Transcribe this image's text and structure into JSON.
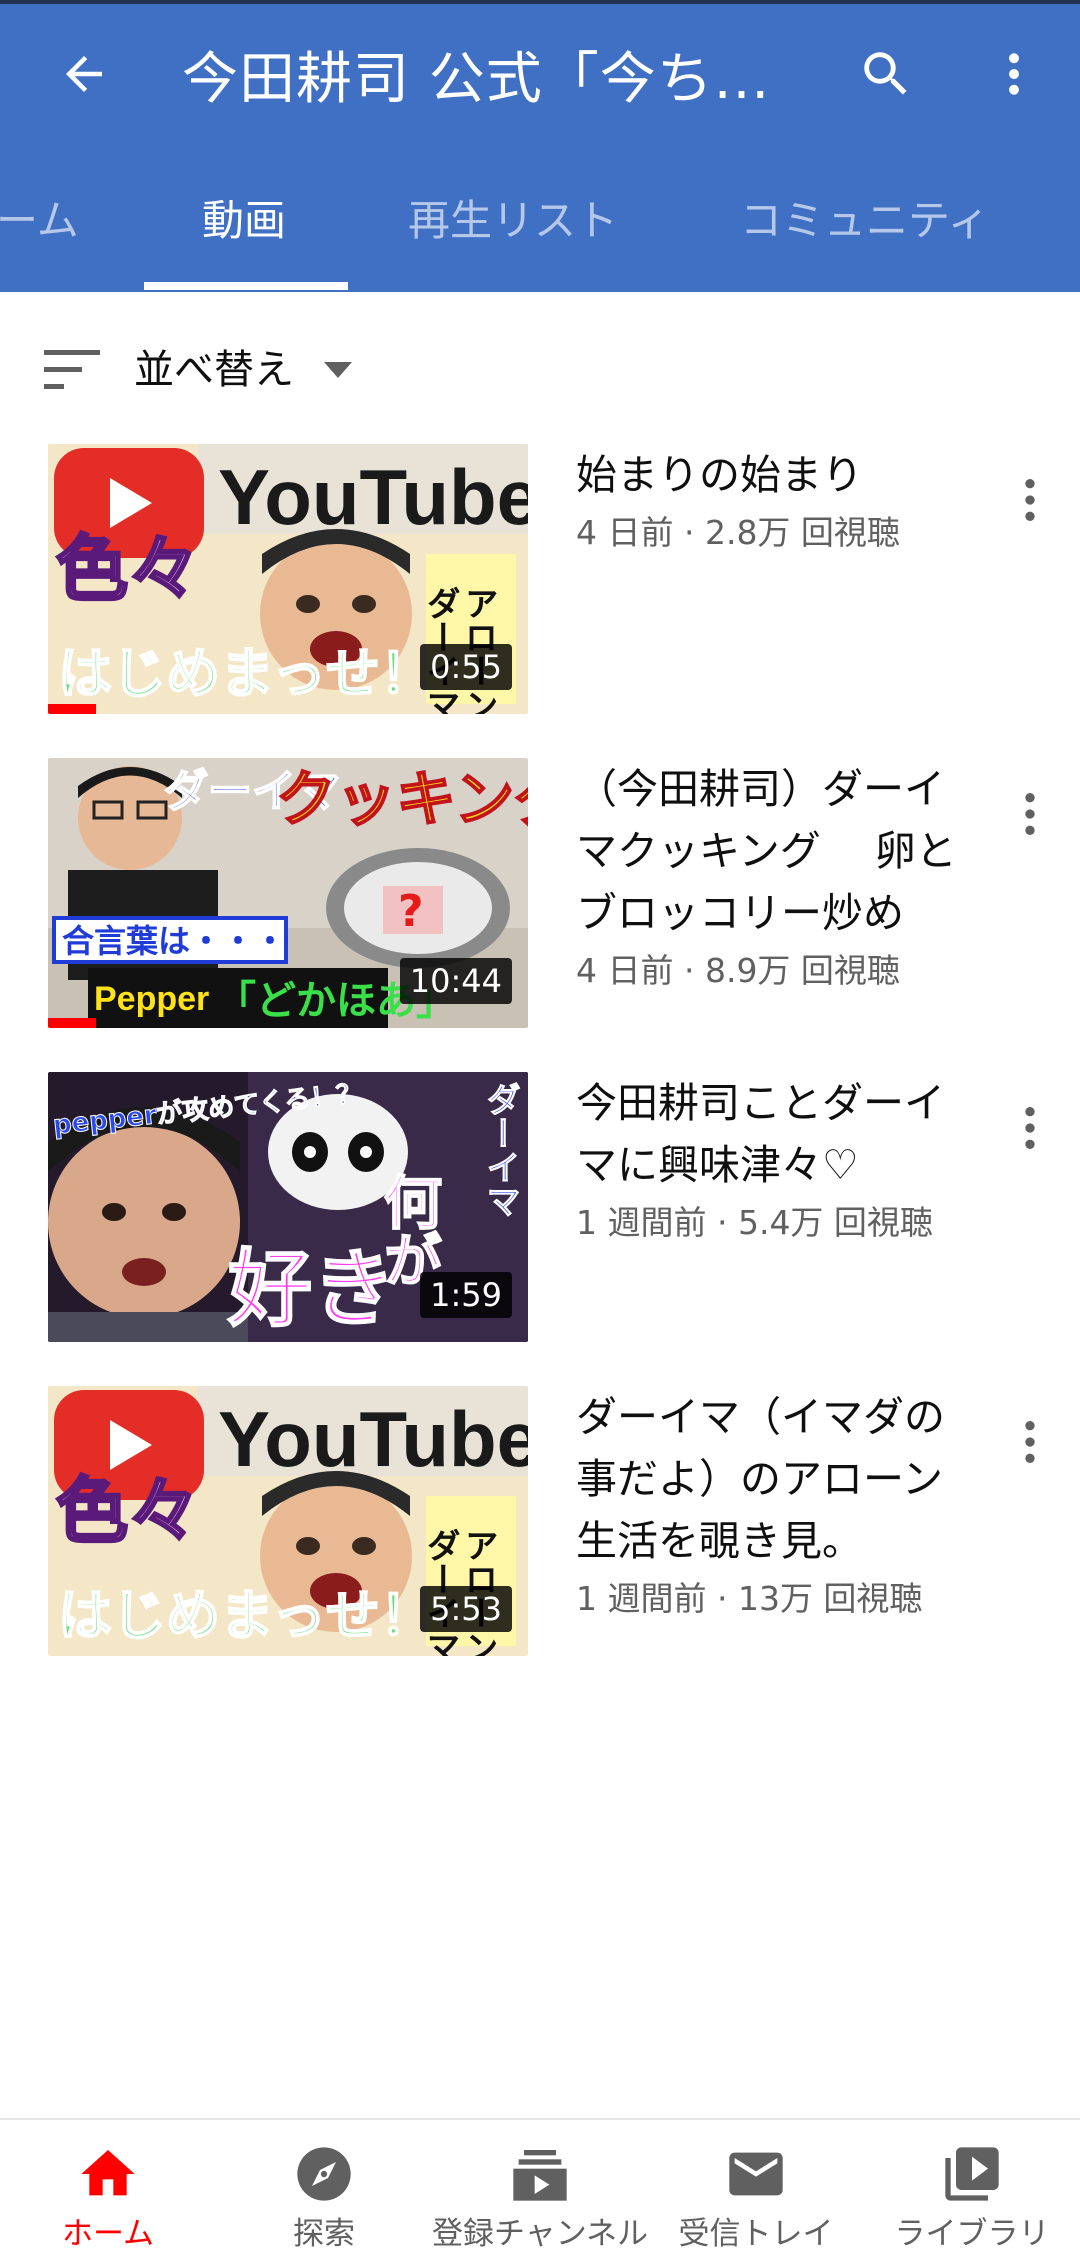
{
  "header": {
    "channel_title": "今田耕司 公式「今ち...",
    "back_icon": "arrow-left-icon",
    "search_icon": "search-icon",
    "more_icon": "more-vert-icon"
  },
  "tabs": [
    {
      "label": "ーム",
      "active": false
    },
    {
      "label": "動画",
      "active": true
    },
    {
      "label": "再生リスト",
      "active": false
    },
    {
      "label": "コミュニティ",
      "active": false
    }
  ],
  "sort": {
    "label": "並べ替え"
  },
  "videos": [
    {
      "title": "始まりの始まり",
      "meta": "4 日前 · 2.8万 回視聴",
      "duration": "0:55",
      "watched_fraction": 0.1,
      "thumb_text": [
        "YouTube",
        "色々",
        "はじめまっせ！",
        "アローン",
        "ダーイマ"
      ]
    },
    {
      "title": "（今田耕司）ダーイマクッキング　 卵とブロッコリー炒め",
      "meta": "4 日前 · 8.9万 回視聴",
      "duration": "10:44",
      "watched_fraction": 0.1,
      "thumb_text": [
        "ダーイマ",
        "クッキング",
        "合言葉は・・・",
        "Pepper",
        "「どかほあ」"
      ]
    },
    {
      "title": "今田耕司ことダーイマに興味津々♡",
      "meta": "1 週間前 · 5.4万 回視聴",
      "duration": "1:59",
      "watched_fraction": 0,
      "thumb_text": [
        "pepperが攻めてくる！？",
        "何が",
        "好き",
        "ダーイマ"
      ]
    },
    {
      "title": "ダーイマ（イマダの事だよ）のアローン生活を覗き見。",
      "meta": "1 週間前 · 13万 回視聴",
      "duration": "5:53",
      "watched_fraction": 0,
      "thumb_text": [
        "YouTube",
        "色々",
        "はじめまっせ！",
        "アローン",
        "ダーイマ"
      ]
    }
  ],
  "bottom_nav": [
    {
      "label": "ホーム",
      "icon": "home-icon",
      "active": true
    },
    {
      "label": "探索",
      "icon": "compass-icon",
      "active": false
    },
    {
      "label": "登録チャンネル",
      "icon": "subscriptions-icon",
      "active": false
    },
    {
      "label": "受信トレイ",
      "icon": "mail-icon",
      "active": false
    },
    {
      "label": "ライブラリ",
      "icon": "library-icon",
      "active": false
    }
  ],
  "colors": {
    "appbar": "#4070c4",
    "accent": "#ff0000",
    "secondary_text": "#606060"
  }
}
